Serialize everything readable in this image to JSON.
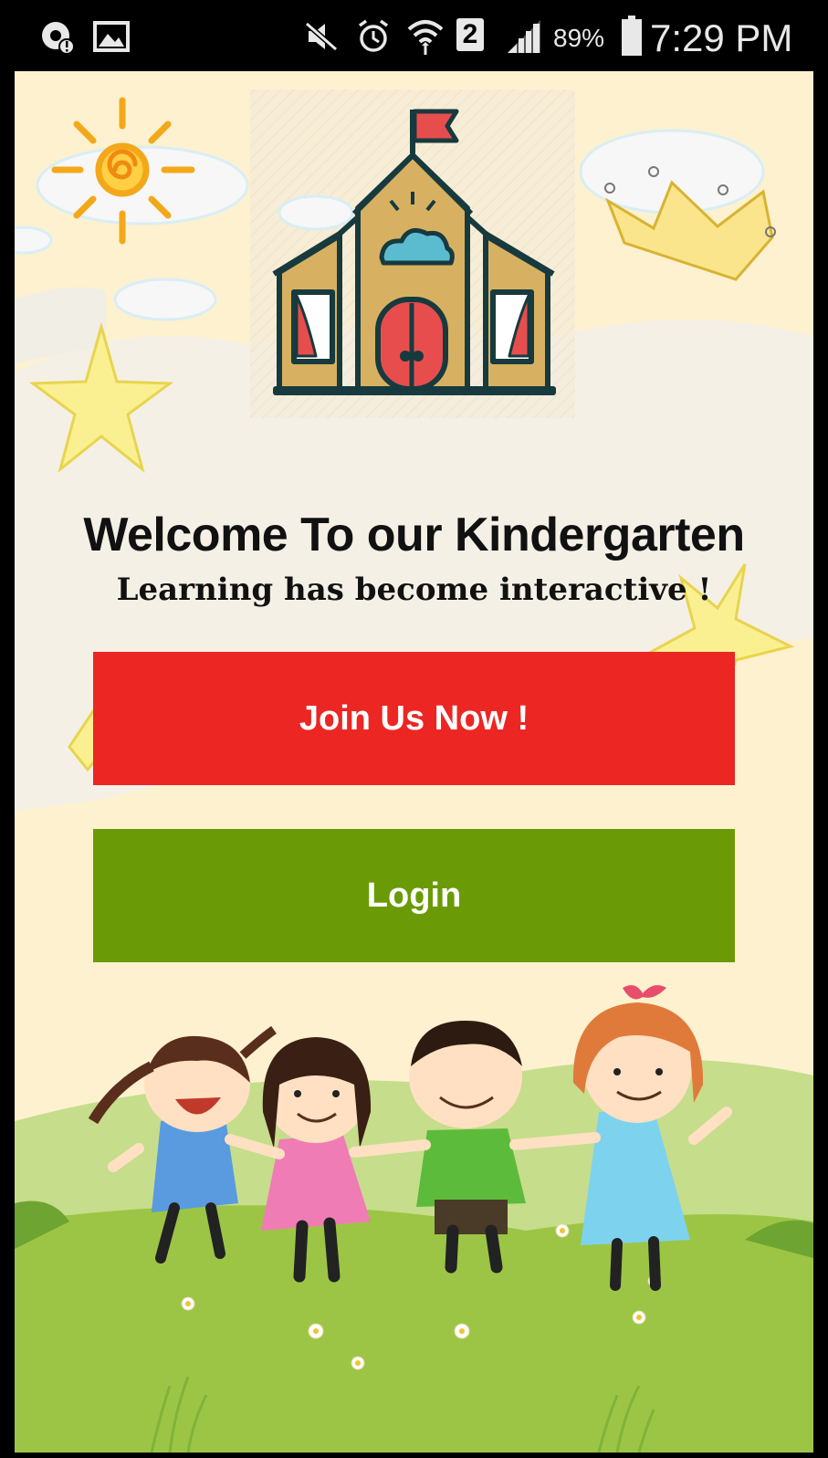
{
  "status_bar": {
    "battery": "89%",
    "time": "7:29 PM",
    "sim_slot": "2",
    "icons": [
      "chrome-icon",
      "image-icon",
      "mute-icon",
      "alarm-icon",
      "wifi-icon",
      "sim-icon",
      "signal-icon",
      "battery-icon"
    ]
  },
  "welcome": {
    "title": "Welcome To our Kindergarten",
    "subtitle": "Learning has become interactive !"
  },
  "buttons": {
    "join_label": "Join Us Now !",
    "login_label": "Login"
  },
  "colors": {
    "join": "#ec2623",
    "login": "#6a9b06",
    "background": "#fdf1cf",
    "grass": "#9cc545"
  }
}
